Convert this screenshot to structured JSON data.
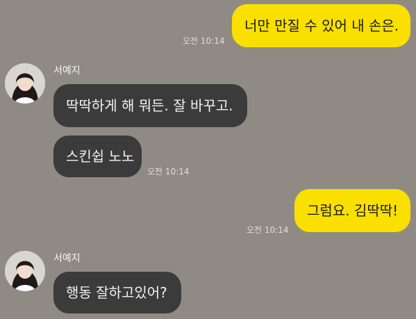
{
  "messages": [
    {
      "direction": "outgoing",
      "text": "너만 만질 수 있어 내 손은.",
      "time": "오전 10:14"
    },
    {
      "direction": "incoming",
      "sender": "서예지",
      "text": "딱딱하게 해 뭐든. 잘 바꾸고."
    },
    {
      "direction": "incoming",
      "text": "스킨쉽 노노",
      "time": "오전 10:14"
    },
    {
      "direction": "outgoing",
      "text": "그럼요. 김딱딱!",
      "time": "오전 10:14"
    },
    {
      "direction": "incoming",
      "sender": "서예지",
      "text": "행동 잘하고있어?"
    }
  ],
  "colors": {
    "background": "#8f8b84",
    "outgoing_bubble": "#f9e000",
    "incoming_bubble": "#3b3b3b",
    "incoming_text": "#f2f2f2",
    "timestamp": "#e2ded7"
  },
  "icons": {
    "contact_avatar": "profile-photo-woman"
  }
}
